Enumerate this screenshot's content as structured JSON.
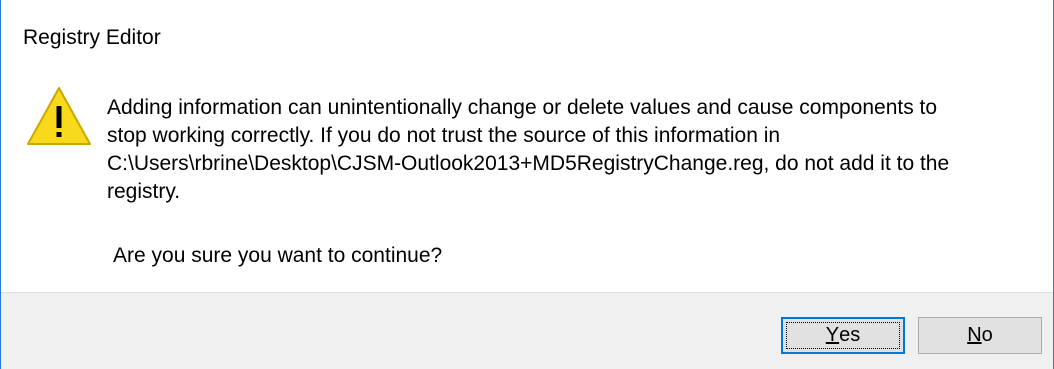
{
  "window": {
    "title": "Registry Editor"
  },
  "icon": {
    "name": "warning-icon",
    "fill": "#f8d91b",
    "stroke": "#c9a800",
    "glyph": "!"
  },
  "message": {
    "lines": [
      "Adding information can unintentionally change or delete values and cause components to",
      "stop working correctly. If you do not trust the source of this information in",
      "C:\\Users\\rbrine\\Desktop\\CJSM-Outlook2013+MD5RegistryChange.reg, do not add it to the",
      "registry."
    ],
    "question": "Are you sure you want to continue?"
  },
  "buttons": {
    "yes": {
      "mnemonic": "Y",
      "rest": "es"
    },
    "no": {
      "mnemonic": "N",
      "rest": "o"
    }
  },
  "colors": {
    "accent": "#0078d7",
    "window_border": "#2b79d6",
    "footer_background": "#f0f0f0",
    "button_background": "#e1e1e1"
  }
}
